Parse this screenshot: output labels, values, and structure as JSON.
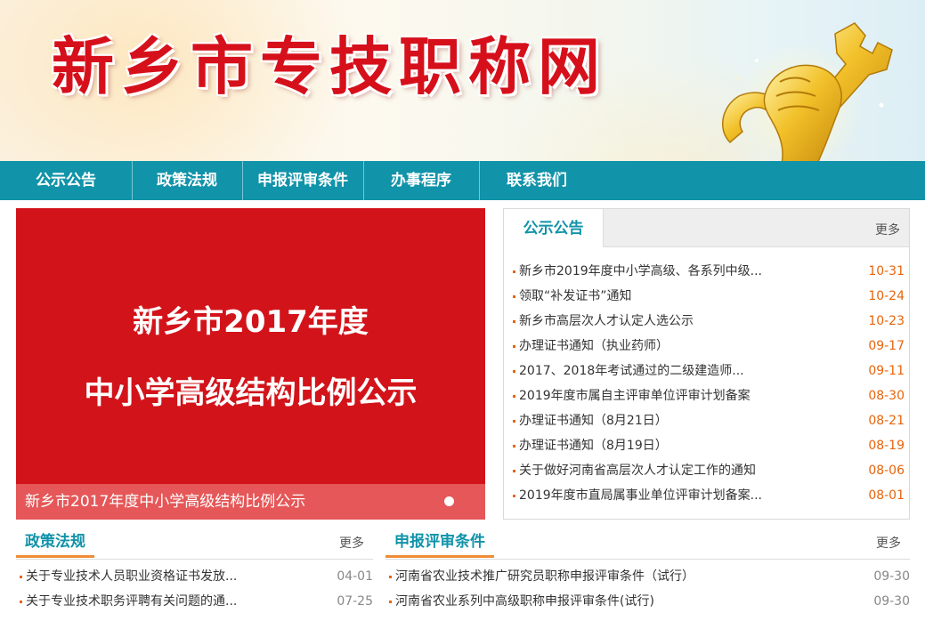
{
  "site": {
    "title": "新乡市专技职称网"
  },
  "nav": {
    "items": [
      {
        "label": "公示公告"
      },
      {
        "label": "政策法规"
      },
      {
        "label": "申报评审条件"
      },
      {
        "label": "办事程序"
      },
      {
        "label": "联系我们"
      }
    ]
  },
  "slider": {
    "slide_line1": "新乡市2017年度",
    "slide_line2": "中小学高级结构比例公示",
    "caption": "新乡市2017年度中小学高级结构比例公示"
  },
  "notice": {
    "title": "公示公告",
    "more": "更多",
    "items": [
      {
        "title": "新乡市2019年度中小学高级、各系列中级...",
        "date": "10-31"
      },
      {
        "title": "领取“补发证书”通知",
        "date": "10-24"
      },
      {
        "title": "新乡市高层次人才认定人选公示",
        "date": "10-23"
      },
      {
        "title": "办理证书通知（执业药师）",
        "date": "09-17"
      },
      {
        "title": "2017、2018年考试通过的二级建造师...",
        "date": "09-11"
      },
      {
        "title": "2019年度市属自主评审单位评审计划备案",
        "date": "08-30"
      },
      {
        "title": "办理证书通知（8月21日）",
        "date": "08-21"
      },
      {
        "title": "办理证书通知（8月19日）",
        "date": "08-19"
      },
      {
        "title": "关于做好河南省高层次人才认定工作的通知",
        "date": "08-06"
      },
      {
        "title": "2019年度市直局属事业单位评审计划备案...",
        "date": "08-01"
      }
    ]
  },
  "policy": {
    "title": "政策法规",
    "more": "更多",
    "items": [
      {
        "title": "关于专业技术人员职业资格证书发放...",
        "date": "04-01"
      },
      {
        "title": "关于专业技术职务评聘有关问题的通...",
        "date": "07-25"
      }
    ]
  },
  "criteria": {
    "title": "申报评审条件",
    "more": "更多",
    "items": [
      {
        "title": "河南省农业技术推广研究员职称申报评审条件（试行）",
        "date": "09-30"
      },
      {
        "title": "河南省农业系列中高级职称申报评审条件(试行)",
        "date": "09-30"
      }
    ]
  },
  "colors": {
    "nav_bg": "#1193a9",
    "title_red": "#d6101b",
    "slide_bg": "#d2141a",
    "accent_orange": "#e8640c",
    "section_underline": "#f08c36"
  },
  "icons": {
    "banner_art": "golden-wrench-fist-icon",
    "slide_indicator": "dot-icon",
    "list_bullet": "square-bullet-icon"
  }
}
